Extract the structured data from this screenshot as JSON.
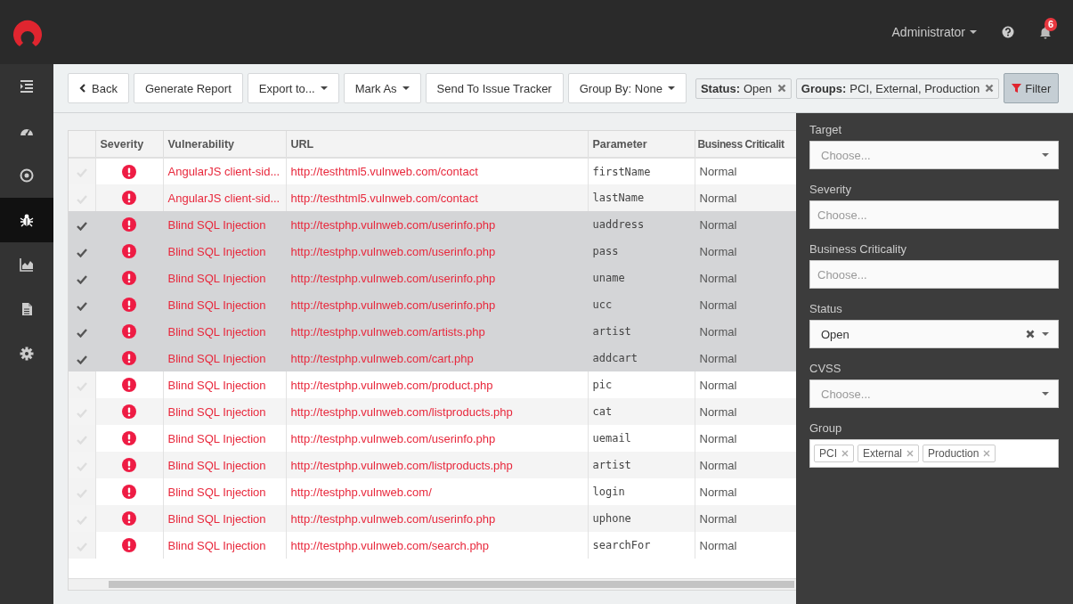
{
  "topbar": {
    "user": "Administrator",
    "notifications": "6"
  },
  "sidebar": {
    "items": [
      {
        "selected": false
      },
      {
        "selected": false
      },
      {
        "selected": false
      },
      {
        "selected": true
      },
      {
        "selected": false
      },
      {
        "selected": false
      },
      {
        "selected": false
      }
    ]
  },
  "toolbar": {
    "buttons": [
      {
        "label": "Back",
        "kind": "back"
      },
      {
        "label": "Generate Report",
        "kind": "plain"
      },
      {
        "label": "Export to...",
        "kind": "dropdown"
      },
      {
        "label": "Mark As",
        "kind": "dropdown"
      },
      {
        "label": "Send To Issue Tracker",
        "kind": "plain"
      },
      {
        "label": "Group By: None",
        "kind": "dropdown"
      }
    ],
    "chips": [
      {
        "label": "Status:",
        "value": "Open"
      },
      {
        "label": "Groups:",
        "value": "PCI, External, Production"
      }
    ],
    "filter": {
      "label": "Filter",
      "selected": true
    }
  },
  "table": {
    "columns": [
      "Severity",
      "Vulnerability",
      "URL",
      "Parameter",
      "Business Criticalit"
    ],
    "rows": [
      {
        "selected": false,
        "vulnerability": "AngularJS client-sid...",
        "url": "http://testhtml5.vulnweb.com/contact",
        "parameter": "firstName",
        "criticality": "Normal"
      },
      {
        "selected": false,
        "vulnerability": "AngularJS client-sid...",
        "url": "http://testhtml5.vulnweb.com/contact",
        "parameter": "lastName",
        "criticality": "Normal"
      },
      {
        "selected": true,
        "vulnerability": "Blind SQL Injection",
        "url": "http://testphp.vulnweb.com/userinfo.php",
        "parameter": "uaddress",
        "criticality": "Normal"
      },
      {
        "selected": true,
        "vulnerability": "Blind SQL Injection",
        "url": "http://testphp.vulnweb.com/userinfo.php",
        "parameter": "pass",
        "criticality": "Normal"
      },
      {
        "selected": true,
        "vulnerability": "Blind SQL Injection",
        "url": "http://testphp.vulnweb.com/userinfo.php",
        "parameter": "uname",
        "criticality": "Normal"
      },
      {
        "selected": true,
        "vulnerability": "Blind SQL Injection",
        "url": "http://testphp.vulnweb.com/userinfo.php",
        "parameter": "ucc",
        "criticality": "Normal"
      },
      {
        "selected": true,
        "vulnerability": "Blind SQL Injection",
        "url": "http://testphp.vulnweb.com/artists.php",
        "parameter": "artist",
        "criticality": "Normal"
      },
      {
        "selected": true,
        "vulnerability": "Blind SQL Injection",
        "url": "http://testphp.vulnweb.com/cart.php",
        "parameter": "addcart",
        "criticality": "Normal"
      },
      {
        "selected": false,
        "vulnerability": "Blind SQL Injection",
        "url": "http://testphp.vulnweb.com/product.php",
        "parameter": "pic",
        "criticality": "Normal"
      },
      {
        "selected": false,
        "vulnerability": "Blind SQL Injection",
        "url": "http://testphp.vulnweb.com/listproducts.php",
        "parameter": "cat",
        "criticality": "Normal"
      },
      {
        "selected": false,
        "vulnerability": "Blind SQL Injection",
        "url": "http://testphp.vulnweb.com/userinfo.php",
        "parameter": "uemail",
        "criticality": "Normal"
      },
      {
        "selected": false,
        "vulnerability": "Blind SQL Injection",
        "url": "http://testphp.vulnweb.com/listproducts.php",
        "parameter": "artist",
        "criticality": "Normal"
      },
      {
        "selected": false,
        "vulnerability": "Blind SQL Injection",
        "url": "http://testphp.vulnweb.com/",
        "parameter": "login",
        "criticality": "Normal"
      },
      {
        "selected": false,
        "vulnerability": "Blind SQL Injection",
        "url": "http://testphp.vulnweb.com/userinfo.php",
        "parameter": "uphone",
        "criticality": "Normal"
      },
      {
        "selected": false,
        "vulnerability": "Blind SQL Injection",
        "url": "http://testphp.vulnweb.com/search.php",
        "parameter": "searchFor",
        "criticality": "Normal"
      }
    ]
  },
  "filter_panel": {
    "fields": [
      {
        "label": "Target",
        "kind": "select",
        "placeholder": "Choose..."
      },
      {
        "label": "Severity",
        "kind": "text",
        "placeholder": "Choose..."
      },
      {
        "label": "Business Criticality",
        "kind": "text",
        "placeholder": "Choose..."
      },
      {
        "label": "Status",
        "kind": "select",
        "value": "Open",
        "clearable": true
      },
      {
        "label": "CVSS",
        "kind": "select",
        "placeholder": "Choose..."
      },
      {
        "label": "Group",
        "kind": "tags",
        "tags": [
          "PCI",
          "External",
          "Production"
        ]
      }
    ]
  }
}
